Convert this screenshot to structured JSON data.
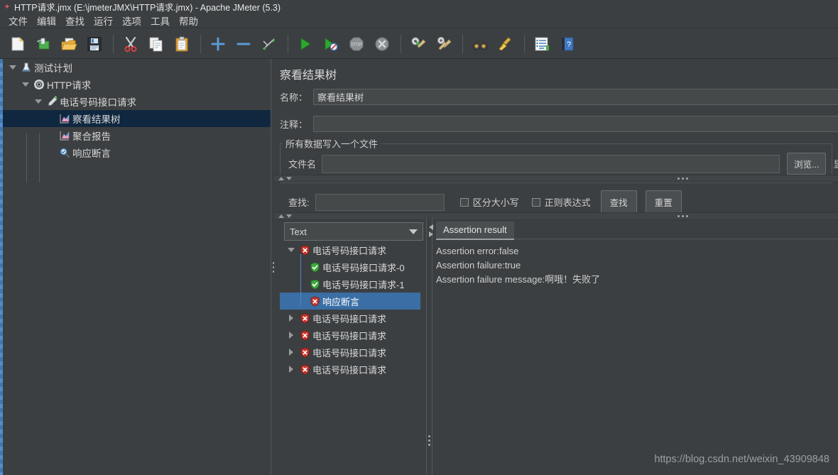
{
  "window": {
    "title": "HTTP请求.jmx (E:\\jmeterJMX\\HTTP请求.jmx) - Apache JMeter (5.3)",
    "app_icon": "jmeter-feather-icon"
  },
  "menubar": {
    "items": [
      {
        "label": "文件",
        "name": "menu-file"
      },
      {
        "label": "编辑",
        "name": "menu-edit"
      },
      {
        "label": "查找",
        "name": "menu-search"
      },
      {
        "label": "运行",
        "name": "menu-run"
      },
      {
        "label": "选项",
        "name": "menu-options"
      },
      {
        "label": "工具",
        "name": "menu-tools"
      },
      {
        "label": "帮助",
        "name": "menu-help"
      }
    ]
  },
  "toolbar": {
    "buttons": [
      {
        "icon": "new-document-icon",
        "name": "toolbar-new"
      },
      {
        "icon": "templates-icon",
        "name": "toolbar-templates"
      },
      {
        "icon": "open-folder-icon",
        "name": "toolbar-open"
      },
      {
        "icon": "save-floppy-icon",
        "name": "toolbar-save"
      },
      {
        "icon": "scissors-cut-icon",
        "name": "toolbar-cut"
      },
      {
        "icon": "copy-icon",
        "name": "toolbar-copy"
      },
      {
        "icon": "paste-clipboard-icon",
        "name": "toolbar-paste"
      },
      {
        "icon": "plus-icon",
        "name": "toolbar-expand"
      },
      {
        "icon": "minus-icon",
        "name": "toolbar-collapse"
      },
      {
        "icon": "toggle-icon",
        "name": "toolbar-toggle"
      },
      {
        "icon": "play-green-icon",
        "name": "toolbar-start"
      },
      {
        "icon": "play-no-pauses-icon",
        "name": "toolbar-start-no-pauses"
      },
      {
        "icon": "stop-icon",
        "name": "toolbar-stop"
      },
      {
        "icon": "shutdown-icon",
        "name": "toolbar-shutdown"
      },
      {
        "icon": "clear-gear-icon",
        "name": "toolbar-clear"
      },
      {
        "icon": "clear-all-gear-icon",
        "name": "toolbar-clear-all"
      },
      {
        "icon": "binoculars-search-icon",
        "name": "toolbar-search"
      },
      {
        "icon": "broom-reset-icon",
        "name": "toolbar-reset-search"
      },
      {
        "icon": "log-list-icon",
        "name": "toolbar-log-viewer"
      },
      {
        "icon": "help-book-icon",
        "name": "toolbar-help"
      }
    ]
  },
  "tree": {
    "nodes": [
      {
        "label": "测试计划",
        "icon": "test-plan-icon",
        "depth": 0,
        "expanded": true,
        "selected": false
      },
      {
        "label": "HTTP请求",
        "icon": "thread-group-gear-icon",
        "depth": 1,
        "expanded": true,
        "selected": false
      },
      {
        "label": "电话号码接口请求",
        "icon": "http-sampler-pen-icon",
        "depth": 2,
        "expanded": true,
        "selected": false
      },
      {
        "label": "察看结果树",
        "icon": "view-results-tree-icon",
        "depth": 3,
        "expanded": null,
        "selected": true
      },
      {
        "label": "聚合报告",
        "icon": "aggregate-report-icon",
        "depth": 3,
        "expanded": null,
        "selected": false
      },
      {
        "label": "响应断言",
        "icon": "response-assertion-icon",
        "depth": 3,
        "expanded": null,
        "selected": false
      }
    ]
  },
  "panel": {
    "title": "察看结果树",
    "name_label": "名称：",
    "name_value": "察看结果树",
    "comment_label": "注释：",
    "comment_value": "",
    "comment_placeholder": "",
    "filegroup_title": "所有数据写入一个文件",
    "filename_label": "文件名",
    "filename_value": "",
    "browse_button": "浏览...",
    "display_button_partial": "显"
  },
  "search_bar": {
    "label": "查找:",
    "value": "",
    "case_sensitive_label": "区分大小写",
    "case_sensitive_checked": false,
    "regex_label": "正则表达式",
    "regex_checked": false,
    "find_button": "查找",
    "reset_button": "重置"
  },
  "renderer": {
    "selected": "Text",
    "options": [
      "Text"
    ]
  },
  "results_tree": {
    "rows": [
      {
        "label": "电话号码接口请求",
        "status": "error",
        "depth": 0,
        "expanded": true,
        "selected": false
      },
      {
        "label": "电话号码接口请求-0",
        "status": "success",
        "depth": 1,
        "expanded": null,
        "selected": false
      },
      {
        "label": "电话号码接口请求-1",
        "status": "success",
        "depth": 1,
        "expanded": null,
        "selected": false
      },
      {
        "label": "响应断言",
        "status": "error",
        "depth": 1,
        "expanded": null,
        "selected": true
      },
      {
        "label": "电话号码接口请求",
        "status": "error",
        "depth": 0,
        "expanded": false,
        "selected": false
      },
      {
        "label": "电话号码接口请求",
        "status": "error",
        "depth": 0,
        "expanded": false,
        "selected": false
      },
      {
        "label": "电话号码接口请求",
        "status": "error",
        "depth": 0,
        "expanded": false,
        "selected": false
      },
      {
        "label": "电话号码接口请求",
        "status": "error",
        "depth": 0,
        "expanded": false,
        "selected": false
      }
    ]
  },
  "assertion": {
    "tab_label": "Assertion result",
    "lines": [
      "Assertion error:false",
      "Assertion failure:true",
      "Assertion failure message:啊哦！失败了"
    ]
  },
  "watermark": "https://blog.csdn.net/weixin_43909848",
  "colors": {
    "background": "#3c3f41",
    "selected_tree_row": "#10283f",
    "selected_result_row": "#3a6ea5",
    "accent_blue": "#4a88c7",
    "error_red": "#c3362c",
    "success_green": "#3fa83f"
  }
}
